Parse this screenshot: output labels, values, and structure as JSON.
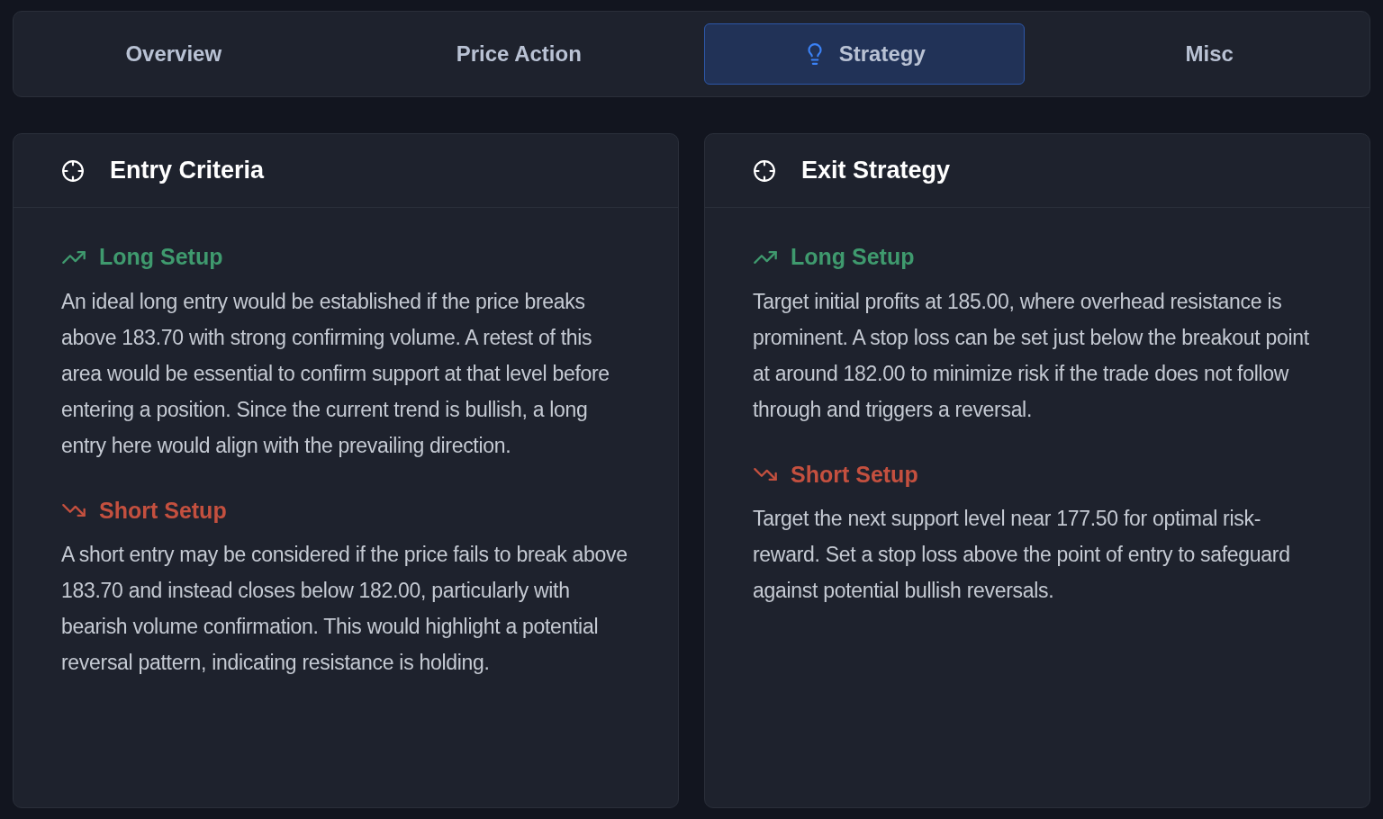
{
  "tabs": [
    {
      "label": "Overview",
      "selected": false
    },
    {
      "label": "Price Action",
      "selected": false
    },
    {
      "label": "Strategy",
      "selected": true
    },
    {
      "label": "Misc",
      "selected": false
    }
  ],
  "cards": [
    {
      "title": "Entry Criteria",
      "sections": [
        {
          "kind": "long",
          "heading": "Long Setup",
          "text": "An ideal long entry would be established if the price breaks above 183.70 with strong confirming volume. A retest of this area would be essential to confirm support at that level before entering a position. Since the current trend is bullish, a long entry here would align with the prevailing direction."
        },
        {
          "kind": "short",
          "heading": "Short Setup",
          "text": "A short entry may be considered if the price fails to break above 183.70 and instead closes below 182.00, particularly with bearish volume confirmation. This would highlight a potential reversal pattern, indicating resistance is holding."
        }
      ]
    },
    {
      "title": "Exit Strategy",
      "sections": [
        {
          "kind": "long",
          "heading": "Long Setup",
          "text": "Target initial profits at 185.00, where overhead resistance is prominent. A stop loss can be set just below the breakout point at around 182.00 to minimize risk if the trade does not follow through and triggers a reversal."
        },
        {
          "kind": "short",
          "heading": "Short Setup",
          "text": "Target the next support level near 177.50 for optimal risk-reward. Set a stop loss above the point of entry to safeguard against potential bullish reversals."
        }
      ]
    }
  ]
}
